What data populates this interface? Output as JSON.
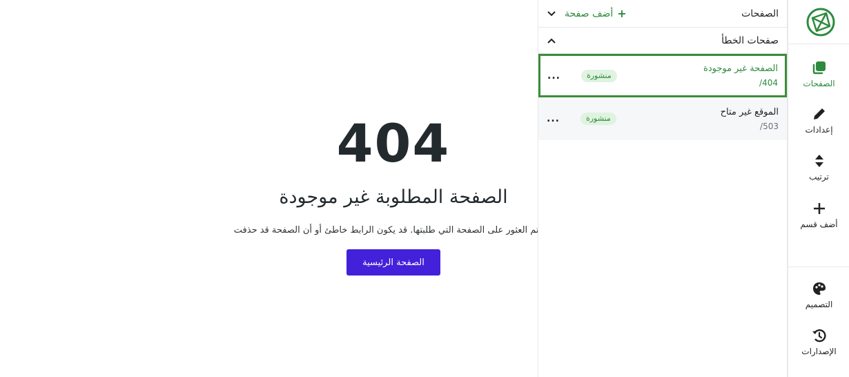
{
  "preview": {
    "code": "404",
    "title": "الصفحة المطلوبة غير موجودة",
    "description": "لم يتم العثور على الصفحة التي طلبتها. قد يكون الرابط خاطئ أو أن الصفحة قد حذفت",
    "home_button": "الصفحة الرئيسية"
  },
  "panel": {
    "title": "الصفحات",
    "add_page": "أضف صفحة",
    "section_title": "صفحات الخطأ",
    "pages": [
      {
        "name": "الصفحة غير موجودة",
        "path": "/404",
        "status": "منشورة",
        "menu": "..."
      },
      {
        "name": "الموقع غير متاح",
        "path": "/503",
        "status": "منشورة",
        "menu": "..."
      }
    ]
  },
  "rail": {
    "items": [
      {
        "label": "الصفحات",
        "icon": "pages-icon"
      },
      {
        "label": "إعدادات",
        "icon": "pencil-icon"
      },
      {
        "label": "ترتيب",
        "icon": "sort-icon"
      },
      {
        "label": "أضف قسم",
        "icon": "plus-icon"
      },
      {
        "label": "التصميم",
        "icon": "palette-icon"
      },
      {
        "label": "الإصدارات",
        "icon": "history-icon"
      }
    ]
  },
  "colors": {
    "accent": "#2e8a3e",
    "button": "#4320d9",
    "active_border": "#3c8c3a",
    "badge_bg": "#dff3e0"
  }
}
